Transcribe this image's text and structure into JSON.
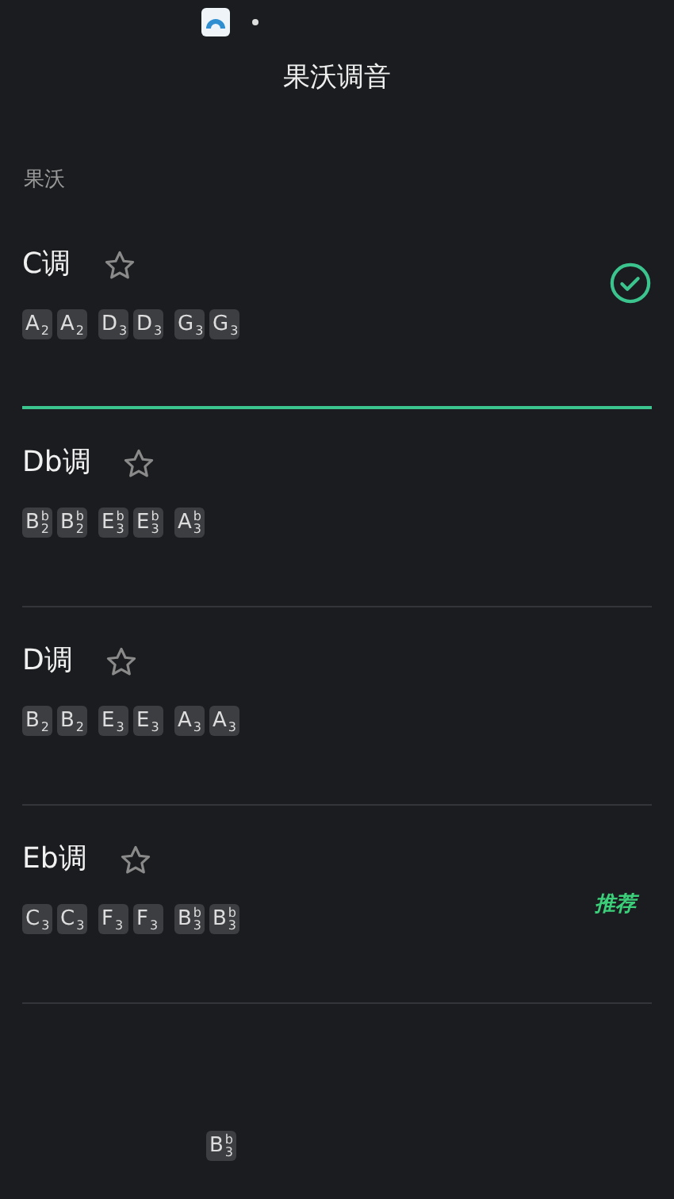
{
  "header": {
    "title": "果沃调音"
  },
  "section_label": "果沃",
  "tunings": [
    {
      "name": "C调",
      "favorite": false,
      "selected": true,
      "groups": [
        [
          {
            "letter": "A",
            "octave": "2"
          },
          {
            "letter": "A",
            "octave": "2"
          }
        ],
        [
          {
            "letter": "D",
            "octave": "3"
          },
          {
            "letter": "D",
            "octave": "3"
          }
        ],
        [
          {
            "letter": "G",
            "octave": "3"
          },
          {
            "letter": "G",
            "octave": "3"
          }
        ]
      ]
    },
    {
      "name": "Db调",
      "favorite": false,
      "selected": false,
      "groups": [
        [
          {
            "letter": "B",
            "accidental": "b",
            "octave": "2"
          },
          {
            "letter": "B",
            "accidental": "b",
            "octave": "2"
          }
        ],
        [
          {
            "letter": "E",
            "accidental": "b",
            "octave": "3"
          },
          {
            "letter": "E",
            "accidental": "b",
            "octave": "3"
          }
        ],
        [
          {
            "letter": "A",
            "accidental": "b",
            "octave": "3"
          }
        ]
      ]
    },
    {
      "name": "D调",
      "favorite": false,
      "selected": false,
      "groups": [
        [
          {
            "letter": "B",
            "octave": "2"
          },
          {
            "letter": "B",
            "octave": "2"
          }
        ],
        [
          {
            "letter": "E",
            "octave": "3"
          },
          {
            "letter": "E",
            "octave": "3"
          }
        ],
        [
          {
            "letter": "A",
            "octave": "3"
          },
          {
            "letter": "A",
            "octave": "3"
          }
        ]
      ]
    },
    {
      "name": "Eb调",
      "favorite": false,
      "selected": false,
      "badge": "推荐",
      "groups": [
        [
          {
            "letter": "C",
            "octave": "3"
          },
          {
            "letter": "C",
            "octave": "3"
          }
        ],
        [
          {
            "letter": "F",
            "octave": "3"
          },
          {
            "letter": "F",
            "octave": "3"
          }
        ],
        [
          {
            "letter": "B",
            "accidental": "b",
            "octave": "3"
          },
          {
            "letter": "B",
            "accidental": "b",
            "octave": "3"
          }
        ]
      ]
    }
  ],
  "partial_row": [
    {
      "letter": "B",
      "accidental": "b",
      "octave": "3"
    }
  ]
}
